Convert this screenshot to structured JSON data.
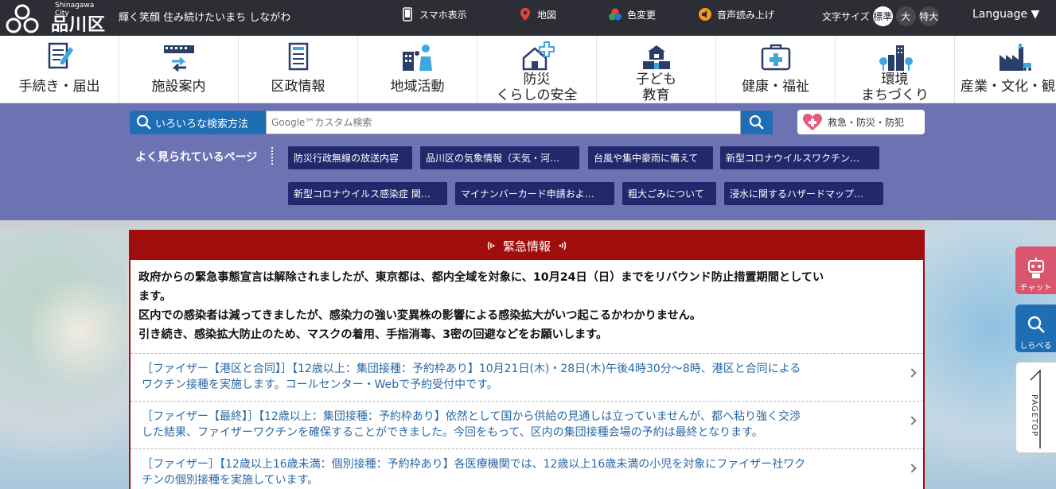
{
  "header": {
    "logo_en": "Shinagawa City",
    "logo_ja": "品川区",
    "slogan": "輝く笑顔 住み続けたいまち しながわ",
    "tools": [
      {
        "label": "スマホ表示",
        "icon": "smartphone-icon"
      },
      {
        "label": "地図",
        "icon": "map-pin-icon"
      },
      {
        "label": "色変更",
        "icon": "color-change-icon"
      },
      {
        "label": "音声読み上げ",
        "icon": "speech-icon"
      }
    ],
    "font_size_label": "文字サイズ",
    "font_sizes": [
      "標準",
      "大",
      "特大"
    ],
    "font_size_selected": "標準",
    "language": "Language ▼"
  },
  "nav": [
    {
      "label": "手続き・届出",
      "icon": "document-pen-icon"
    },
    {
      "label": "施設案内",
      "icon": "facility-directions-icon"
    },
    {
      "label": "区政情報",
      "icon": "ward-document-icon"
    },
    {
      "label": "地域活動",
      "icon": "community-icon"
    },
    {
      "label_line1": "防災",
      "label_line2": "くらしの安全",
      "icon": "house-safety-icon"
    },
    {
      "label_line1": "子ども",
      "label_line2": "教育",
      "icon": "school-icon"
    },
    {
      "label": "健康・福祉",
      "icon": "medical-kit-icon"
    },
    {
      "label_line1": "環境",
      "label_line2": "まちづくり",
      "icon": "city-environment-icon"
    },
    {
      "label": "産業・文化・観光",
      "icon": "industry-icon"
    }
  ],
  "search": {
    "method_label": "いろいろな検索方法",
    "placeholder": "Google™カスタム検索",
    "emergency_label": "救急・防災・防犯"
  },
  "popular": {
    "label": "よく見られているページ",
    "items": [
      "防災行政無線の放送内容",
      "品川区の気象情報（天気・河…",
      "台風や集中豪雨に備えて",
      "新型コロナウイルスワクチン…",
      "新型コロナウイルス感染症 関…",
      "マイナンバーカード申請およ…",
      "粗大ごみについて",
      "浸水に関するハザードマップ…"
    ]
  },
  "emergency": {
    "title": "緊急情報",
    "message_lines": [
      "政府からの緊急事態宣言は解除されましたが、東京都は、都内全域を対象に、10月24日（日）までをリバウンド防止措置期間としてい",
      "ます。",
      "区内での感染者は減ってきましたが、感染力の強い変異株の影響による感染拡大がいつ起こるかわかりません。",
      "引き続き、感染拡大防止のため、マスクの着用、手指消毒、3密の回避などをお願いします。"
    ],
    "links": [
      {
        "line1": "［ファイザー【港区と合同】］【12歳以上：集団接種：予約枠あり】10月21日(木)・28日(木)午後4時30分～8時、港区と合同による",
        "line2": "ワクチン接種を実施します。コールセンター・Webで予約受付中です。"
      },
      {
        "line1": "［ファイザー【最終】］【12歳以上：集団接種：予約枠あり】依然として国から供給の見通しは立っていませんが、都へ粘り強く交渉",
        "line2": "した結果、ファイザーワクチンを確保することができました。今回をもって、区内の集団接種会場の予約は最終となります。"
      },
      {
        "line1": "［ファイザー］【12歳以上16歳未満：個別接種：予約枠あり】各医療機関では、12歳以上16歳未満の小児を対象にファイザー社ワク",
        "line2": "チンの個別接種を実施しています。"
      }
    ]
  },
  "side": {
    "chat": "チャット",
    "search": "しらべる",
    "pagetop": "PAGETOP"
  },
  "colors": {
    "topbar": "#2d2d35",
    "band": "#6d72b3",
    "pill": "#23276c",
    "accent_blue": "#1f6db3",
    "emergency_red": "#a00d0d",
    "link_blue": "#2b68a7"
  }
}
